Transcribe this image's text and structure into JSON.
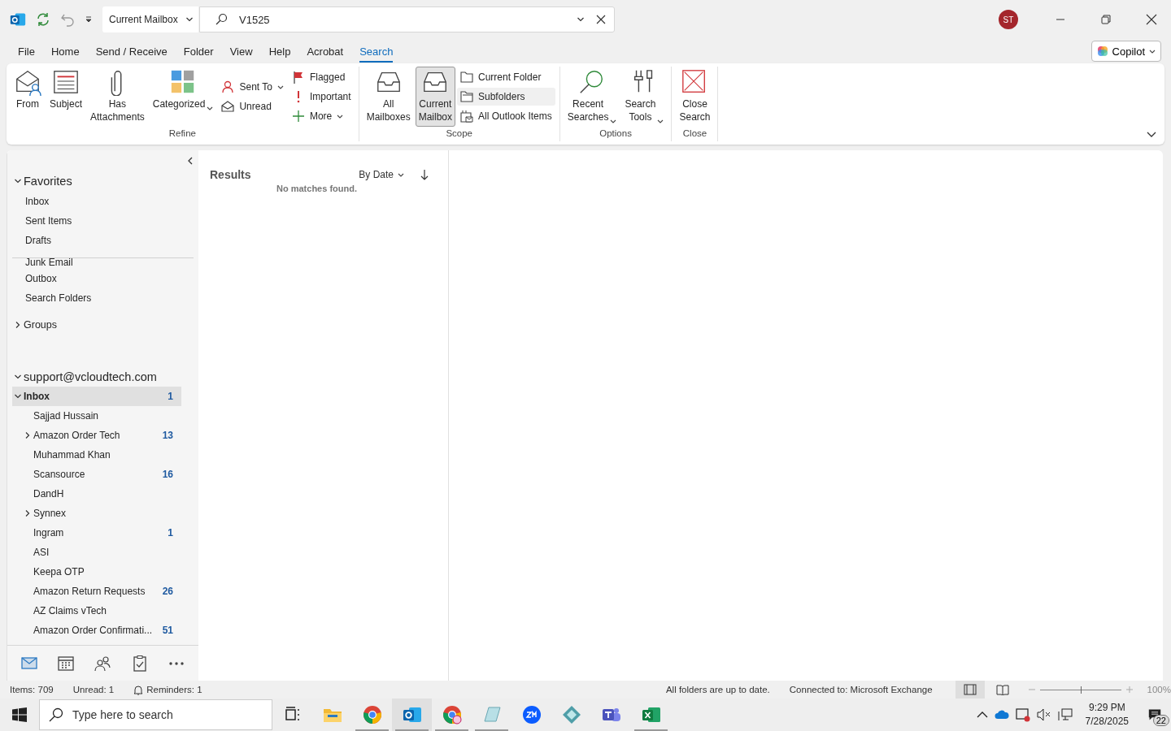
{
  "title_bar": {
    "scope": "Current Mailbox",
    "search_value": "V1525",
    "avatar": "ST"
  },
  "menu_tabs": [
    {
      "label": "File",
      "selected": false
    },
    {
      "label": "Home",
      "selected": false
    },
    {
      "label": "Send / Receive",
      "selected": false
    },
    {
      "label": "Folder",
      "selected": false
    },
    {
      "label": "View",
      "selected": false
    },
    {
      "label": "Help",
      "selected": false
    },
    {
      "label": "Acrobat",
      "selected": false
    },
    {
      "label": "Search",
      "selected": true
    }
  ],
  "copilot": {
    "label": "Copilot"
  },
  "ribbon": {
    "groups": [
      {
        "label": "Refine",
        "buttons": [
          {
            "kind": "large",
            "label": "From",
            "dropdown": false,
            "selected": false
          },
          {
            "kind": "large",
            "label": "Subject",
            "dropdown": false,
            "selected": false
          },
          {
            "kind": "large",
            "label": "Has Attachments",
            "dropdown": false,
            "selected": false
          },
          {
            "kind": "large",
            "label": "Categorized",
            "dropdown": true,
            "selected": false
          },
          {
            "kind": "stack",
            "items": [
              {
                "label": "Sent To",
                "dropdown": true,
                "selected": false
              },
              {
                "label": "Unread",
                "dropdown": false,
                "selected": false
              }
            ]
          },
          {
            "kind": "stack",
            "items": [
              {
                "label": "Flagged",
                "dropdown": false,
                "selected": false
              },
              {
                "label": "Important",
                "dropdown": false,
                "selected": false
              },
              {
                "label": "More",
                "dropdown": true,
                "selected": false
              }
            ]
          }
        ]
      },
      {
        "label": "Scope",
        "buttons": [
          {
            "kind": "large",
            "label": "All Mailboxes",
            "dropdown": false,
            "selected": false
          },
          {
            "kind": "large",
            "label": "Current Mailbox",
            "dropdown": false,
            "selected": true
          },
          {
            "kind": "stack",
            "items": [
              {
                "label": "Current Folder",
                "dropdown": false,
                "selected": false
              },
              {
                "label": "Subfolders",
                "dropdown": false,
                "selected": true
              },
              {
                "label": "All Outlook Items",
                "dropdown": false,
                "selected": false
              }
            ]
          }
        ]
      },
      {
        "label": "Options",
        "buttons": [
          {
            "kind": "large",
            "label": "Recent Searches",
            "dropdown": true,
            "selected": false
          },
          {
            "kind": "large",
            "label": "Search Tools",
            "dropdown": true,
            "selected": false
          }
        ]
      },
      {
        "label": "Close",
        "buttons": [
          {
            "kind": "large",
            "label": "Close Search",
            "dropdown": false,
            "selected": false
          }
        ]
      }
    ]
  },
  "folder_pane": {
    "favorites": {
      "label": "Favorites",
      "expanded": true,
      "items": [
        {
          "label": "Inbox"
        },
        {
          "label": "Sent Items"
        },
        {
          "label": "Drafts"
        }
      ]
    },
    "more_folders": [
      {
        "label": "Junk Email"
      },
      {
        "label": "Outbox"
      },
      {
        "label": "Search Folders"
      }
    ],
    "groups": {
      "label": "Groups",
      "expanded": false
    },
    "account": {
      "label": "support@vcloudtech.com",
      "expanded": true,
      "folders": [
        {
          "label": "Inbox",
          "count": "1",
          "selected": true,
          "expanded": true,
          "children": [
            {
              "label": "Sajjad Hussain",
              "kind": "plain"
            },
            {
              "label": "Amazon Order Tech",
              "count": "13",
              "kind": "collapsed"
            },
            {
              "label": "Muhammad Khan",
              "kind": "plain"
            },
            {
              "label": "Scansource",
              "count": "16",
              "kind": "plain"
            },
            {
              "label": "DandH",
              "kind": "plain"
            },
            {
              "label": "Synnex",
              "kind": "collapsed"
            },
            {
              "label": "Ingram",
              "count": "1",
              "kind": "plain"
            },
            {
              "label": "ASI",
              "kind": "plain"
            },
            {
              "label": "Keepa OTP",
              "kind": "plain"
            },
            {
              "label": "Amazon Return Requests",
              "count": "26",
              "kind": "plain"
            },
            {
              "label": "AZ Claims vTech",
              "kind": "plain"
            },
            {
              "label": "Amazon Order Confirmati...",
              "count": "51",
              "kind": "plain"
            }
          ]
        }
      ]
    }
  },
  "nav_bar": [
    {
      "selected": true
    },
    {
      "selected": false
    },
    {
      "selected": false
    },
    {
      "selected": false
    },
    {
      "selected": false
    }
  ],
  "results": {
    "title": "Results",
    "sort": "By Date",
    "message": "No matches found."
  },
  "status_bar": {
    "items": "Items: 709",
    "unread": "Unread: 1",
    "reminders": "Reminders: 1",
    "sync": "All folders are up to date.",
    "connection": "Connected to: Microsoft Exchange",
    "views": [
      {
        "selected": true
      },
      {
        "selected": false
      }
    ],
    "zoom_slider": {
      "level": 0.5
    },
    "zoom": "100%"
  },
  "taskbar": {
    "search_placeholder": "Type here to search",
    "apps": [
      {
        "selected": false,
        "running": false
      },
      {
        "selected": false,
        "running": false
      },
      {
        "selected": false,
        "running": true
      },
      {
        "selected": true,
        "running": true
      },
      {
        "selected": false,
        "running": true
      },
      {
        "selected": false,
        "running": true
      },
      {
        "selected": false,
        "running": false
      },
      {
        "selected": false,
        "running": false
      },
      {
        "selected": false,
        "running": false
      },
      {
        "selected": false,
        "running": true
      }
    ],
    "time": "9:29 PM",
    "date": "7/28/2025",
    "notifications": "22"
  }
}
